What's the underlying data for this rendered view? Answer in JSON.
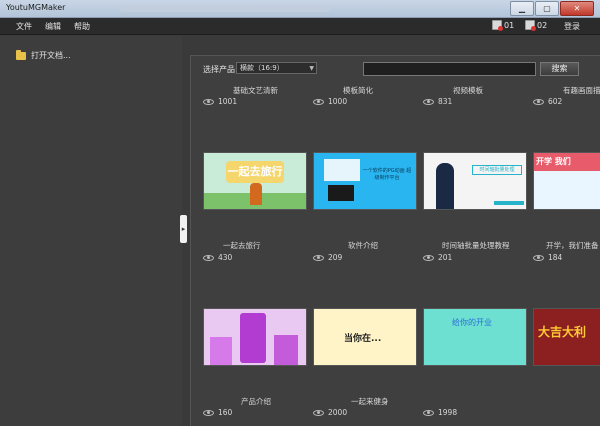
{
  "window": {
    "title": "YoutuMGMaker"
  },
  "menu": {
    "items": [
      "文件",
      "编辑",
      "帮助"
    ]
  },
  "status": {
    "badge1": "01",
    "badge2": "02",
    "login": "登录"
  },
  "sidebar": {
    "open_doc": "打开文档..."
  },
  "filter": {
    "label": "选择产品:",
    "selected": "横款（16:9）",
    "search_button": "搜索"
  },
  "row0": [
    {
      "title": "基础文艺清新",
      "views": "1001"
    },
    {
      "title": "模板简化",
      "views": "1000"
    },
    {
      "title": "视频模板",
      "views": "831"
    },
    {
      "title": "有趣画面描述",
      "views": "602"
    }
  ],
  "row1": [
    {
      "title": "一起去旅行",
      "views": "430",
      "thumb_text": "一起去旅行"
    },
    {
      "title": "软件介绍",
      "views": "209",
      "thumb_text": "一个软件的PG动画 超级制作平台"
    },
    {
      "title": "时间轴批量处理教程",
      "views": "201",
      "thumb_text": "时间轴批量处理"
    },
    {
      "title": "开学，我们准备",
      "views": "184",
      "thumb_text": "开学 我们"
    }
  ],
  "row2": [
    {
      "title": "产品介绍",
      "views": "160"
    },
    {
      "title": "一起来健身",
      "views": "2000",
      "thumb_text": "当你在..."
    },
    {
      "title": "",
      "views": "1998",
      "thumb_text": "给你的开业"
    },
    {
      "title": "",
      "views": "",
      "thumb_text": "大吉大利"
    }
  ]
}
